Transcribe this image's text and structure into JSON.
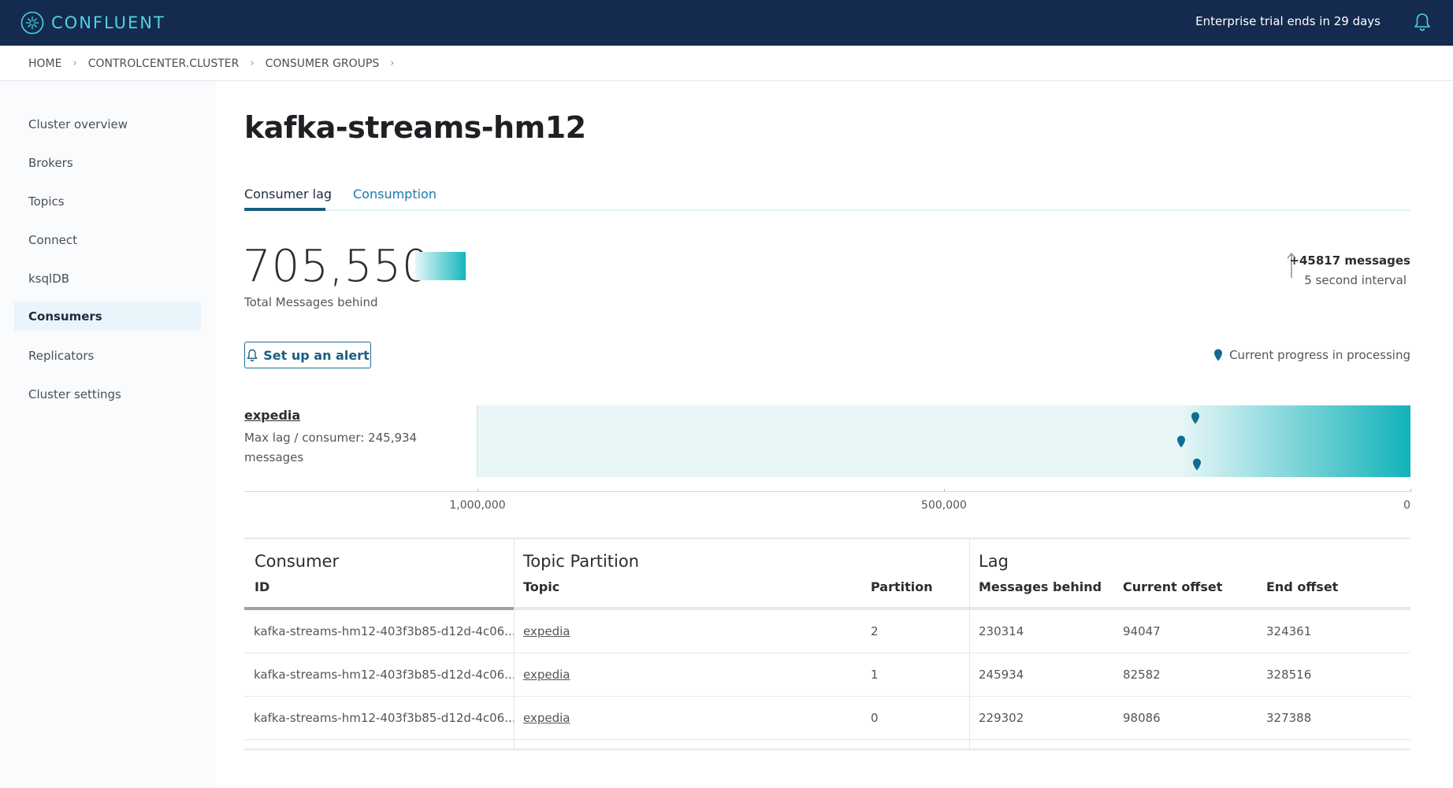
{
  "header": {
    "brand": "CONFLUENT",
    "trial_notice": "Enterprise trial ends in 29 days",
    "icons": [
      "confluent-logo-icon",
      "bell-icon"
    ],
    "colors": {
      "bar": "#142a4e",
      "brand": "#4fd1e6"
    }
  },
  "breadcrumb": {
    "items": [
      "HOME",
      "CONTROLCENTER.CLUSTER",
      "CONSUMER GROUPS"
    ],
    "separator": "›"
  },
  "sidebar": {
    "items": [
      {
        "label": "Cluster overview"
      },
      {
        "label": "Brokers"
      },
      {
        "label": "Topics"
      },
      {
        "label": "Connect"
      },
      {
        "label": "ksqlDB"
      },
      {
        "label": "Consumers",
        "active": true
      },
      {
        "label": "Replicators"
      },
      {
        "label": "Cluster settings"
      }
    ]
  },
  "page": {
    "title": "kafka-streams-hm12",
    "tabs": [
      {
        "label": "Consumer lag",
        "active": true
      },
      {
        "label": "Consumption",
        "active": false
      }
    ]
  },
  "summary": {
    "total": "705,550",
    "total_label": "Total Messages behind",
    "delta": "+45817 messages",
    "interval": "5 second interval"
  },
  "alert_button": {
    "label": "Set up an alert"
  },
  "legend": {
    "label": "Current progress in processing"
  },
  "consumer_chart": {
    "name": "expedia",
    "max_lag": "Max lag / consumer: 245,934 messages",
    "axis_labels": [
      "1,000,000",
      "500,000",
      "0"
    ],
    "axis_max": 1000000,
    "max_lag_value": 245934,
    "partition_lags": [
      230314,
      245934,
      229302
    ],
    "accent": "#12b3ba"
  },
  "table": {
    "groups": [
      "Consumer",
      "Topic Partition",
      "Lag"
    ],
    "columns": [
      "ID",
      "Topic",
      "Partition",
      "Messages behind",
      "Current offset",
      "End offset"
    ],
    "rows": [
      {
        "id": "kafka-streams-hm12-403f3b85-d12d-4c06...",
        "topic": "expedia",
        "partition": "2",
        "behind": "230314",
        "current": "94047",
        "end": "324361"
      },
      {
        "id": "kafka-streams-hm12-403f3b85-d12d-4c06...",
        "topic": "expedia",
        "partition": "1",
        "behind": "245934",
        "current": "82582",
        "end": "328516"
      },
      {
        "id": "kafka-streams-hm12-403f3b85-d12d-4c06...",
        "topic": "expedia",
        "partition": "0",
        "behind": "229302",
        "current": "98086",
        "end": "327388"
      }
    ]
  }
}
